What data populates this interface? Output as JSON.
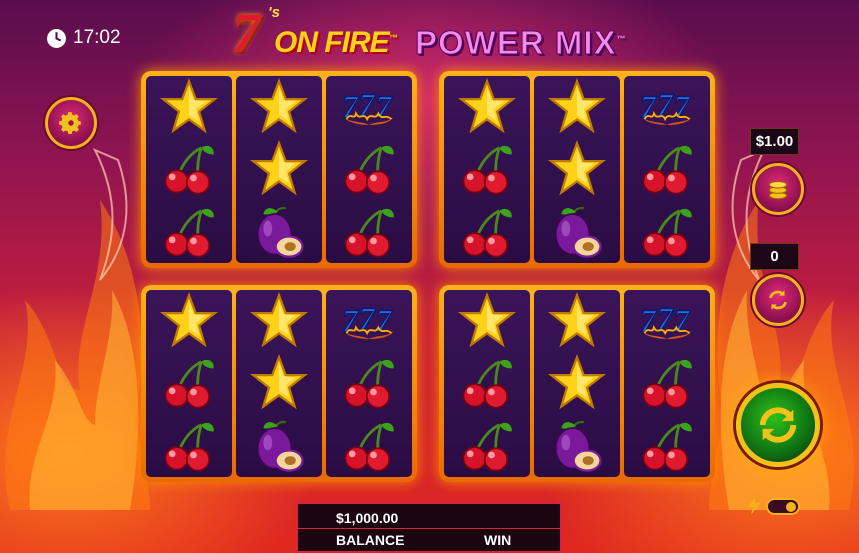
{
  "status": {
    "time": "17:02"
  },
  "logo": {
    "seven": "7",
    "sup": "'s",
    "fire": "ON FIRE",
    "tm": "™",
    "power_mix": "POWER MIX",
    "tm2": "™"
  },
  "controls": {
    "bet": "$1.00",
    "autoplay_count": "0"
  },
  "footer": {
    "balance_value": "$1,000.00",
    "balance_label": "BALANCE",
    "win_label": "WIN"
  },
  "grids": [
    {
      "reels": [
        [
          "star",
          "cherry",
          "cherry"
        ],
        [
          "star",
          "star",
          "plum"
        ],
        [
          "seven",
          "cherry",
          "cherry"
        ]
      ]
    },
    {
      "reels": [
        [
          "star",
          "cherry",
          "cherry"
        ],
        [
          "star",
          "star",
          "plum"
        ],
        [
          "seven",
          "cherry",
          "cherry"
        ]
      ]
    },
    {
      "reels": [
        [
          "star",
          "cherry",
          "cherry"
        ],
        [
          "star",
          "star",
          "plum"
        ],
        [
          "seven",
          "cherry",
          "cherry"
        ]
      ]
    },
    {
      "reels": [
        [
          "star",
          "cherry",
          "cherry"
        ],
        [
          "star",
          "star",
          "plum"
        ],
        [
          "seven",
          "cherry",
          "cherry"
        ]
      ]
    }
  ],
  "colors": {
    "frame": "#ffb21a",
    "reel_bg": "#3a1458",
    "accent": "#f2b21a",
    "spin": "#2ec01c"
  },
  "icons": [
    "clock-icon",
    "gear-icon",
    "coins-icon",
    "autoplay-icon",
    "spin-icon",
    "lightning-icon",
    "toggle-switch"
  ]
}
